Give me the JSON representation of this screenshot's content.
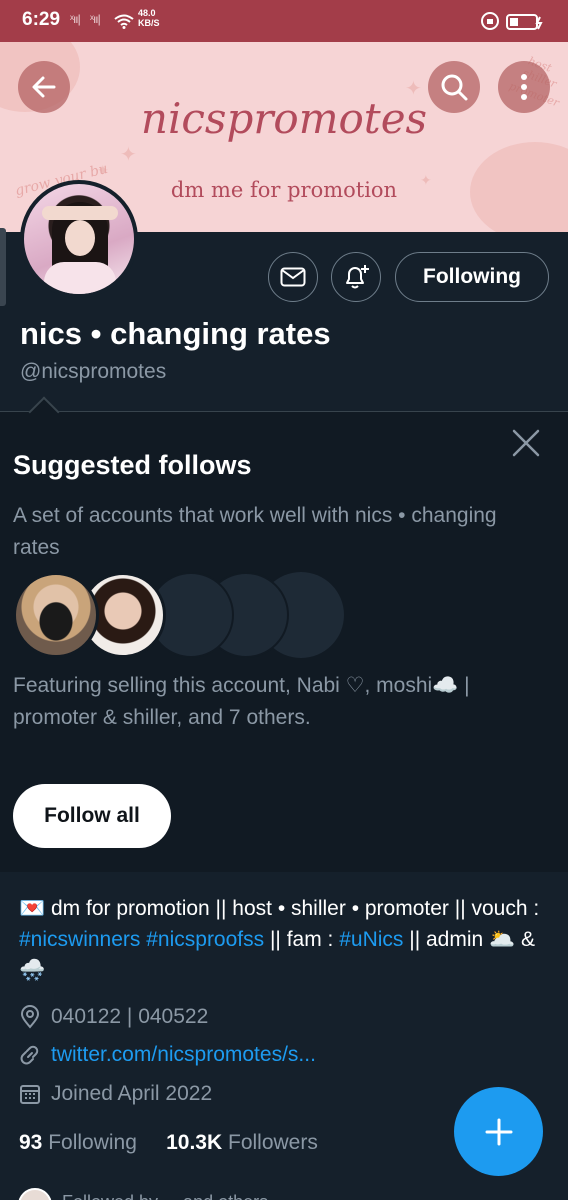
{
  "status_bar": {
    "time": "6:29",
    "net_speed_value": "48.0",
    "net_speed_unit": "KB/S"
  },
  "banner": {
    "title": "nicspromotes",
    "subtitle": "dm me for promotion",
    "deco_left": "grow your bu",
    "deco_right_1": "host",
    "deco_right_2": "shiller",
    "deco_right_3": "promoter"
  },
  "profile": {
    "display_name": "nics • changing rates",
    "handle": "@nicspromotes",
    "following_button": "Following"
  },
  "suggested": {
    "title": "Suggested follows",
    "description": "A set of accounts that work well with nics • changing rates",
    "featuring": "Featuring selling this account, Nabi ♡, moshi☁️ | promoter & shiller, and 7 others.",
    "follow_all": "Follow all"
  },
  "bio": {
    "part1": "💌 dm for promotion || host • shiller • promoter || vouch : ",
    "tag1": "#nicswinners",
    "tag2": "#nicsproofss",
    "part2": " || fam : ",
    "tag3": "#uNics",
    "part3": " || admin 🌥️ & 🌨️"
  },
  "meta": {
    "location": "040122 | 040522",
    "link": "twitter.com/nicspromotes/s...",
    "joined": "Joined April 2022"
  },
  "counts": {
    "following_num": "93",
    "following_label": "Following",
    "followers_num": "10.3K",
    "followers_label": "Followers"
  },
  "bottom": {
    "peek_text": "Followed by ... and others"
  },
  "colors": {
    "accent": "#1d9bf0",
    "background": "#15202b",
    "status_bar": "#a33d49",
    "banner": "#f6d4d5"
  }
}
